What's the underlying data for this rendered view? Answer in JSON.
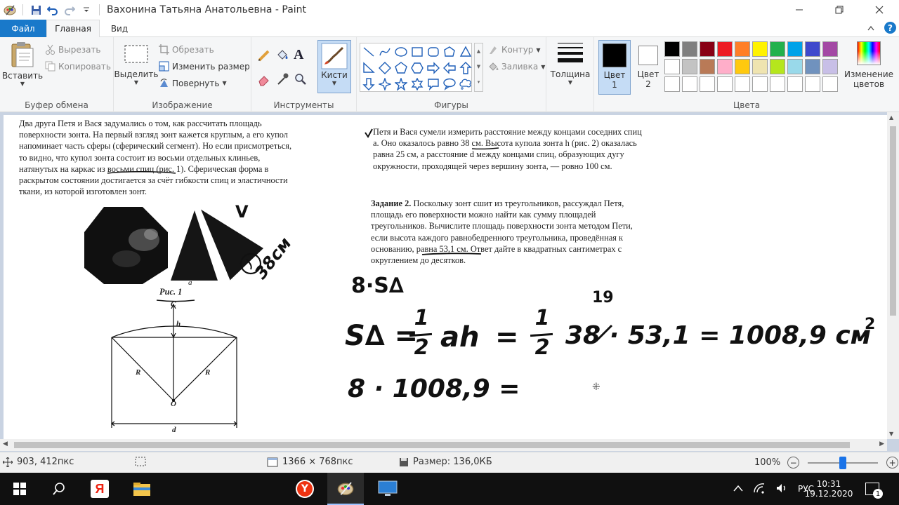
{
  "window": {
    "title": "Вахонина Татьяна Анатольевна - Paint"
  },
  "tabs": {
    "file": "Файл",
    "home": "Главная",
    "view": "Вид"
  },
  "ribbon": {
    "clipboard": {
      "label": "Буфер обмена",
      "paste": "Вставить",
      "cut": "Вырезать",
      "copy": "Копировать"
    },
    "image": {
      "label": "Изображение",
      "select": "Выделить",
      "crop": "Обрезать",
      "resize": "Изменить размер",
      "rotate": "Повернуть"
    },
    "tools": {
      "label": "Инструменты",
      "brushes": "Кисти"
    },
    "shapes": {
      "label": "Фигуры",
      "outline": "Контур",
      "fill": "Заливка"
    },
    "size": {
      "label": "Толщина"
    },
    "colors": {
      "label": "Цвета",
      "color1_line1": "Цвет",
      "color1_line2": "1",
      "color2_line1": "Цвет",
      "color2_line2": "2",
      "edit_line1": "Изменение",
      "edit_line2": "цветов",
      "color1_value": "#000000",
      "color2_value": "#ffffff",
      "palette": [
        "#000000",
        "#7f7f7f",
        "#880015",
        "#ed1c24",
        "#ff7f27",
        "#fff200",
        "#22b14c",
        "#00a2e8",
        "#3f48cc",
        "#a349a4",
        "#ffffff",
        "#c3c3c3",
        "#b97a57",
        "#ffaec9",
        "#ffc90e",
        "#efe4b0",
        "#b5e61d",
        "#99d9ea",
        "#7092be",
        "#c8bfe7",
        "#ffffff",
        "#ffffff",
        "#ffffff",
        "#ffffff",
        "#ffffff",
        "#ffffff",
        "#ffffff",
        "#ffffff",
        "#ffffff",
        "#ffffff"
      ]
    }
  },
  "document": {
    "left_paragraph": [
      "Два друга Петя и Вася задумались о том, как рассчитать площадь",
      "поверхности зонта. На первый взгляд зонт кажется круглым, а его купол",
      "напоминает часть сферы (сферический сегмент). Но если присмотреться,",
      "то видно, что купол зонта состоит из восьми отдельных клиньев,",
      "натянутых на каркас из восьми спиц (рис. 1). Сферическая форма в",
      "раскрытом состоянии достигается за счёт гибкости спиц и эластичности",
      "ткани, из которой изготовлен зонт."
    ],
    "right_paragraph": [
      "Петя и Вася сумели измерить расстояние между концами соседних спиц",
      "a. Оно оказалось равно 38 см. Высота купола зонта h (рис. 2) оказалась",
      "равна 25 см, а расстояние d между концами спиц, образующих дугу",
      "окружности, проходящей через вершину зонта, — ровно 100 см."
    ],
    "task_title": "Задание 2.",
    "task_paragraph": [
      "Поскольку зонт сшит из треугольников, рассуждал Петя,",
      "площадь его поверхности можно найти как сумму площадей",
      "треугольников. Вычислите площадь поверхности зонта методом Пети,",
      "если высота каждого равнобедренного треугольника, проведённая к",
      "основанию, равна 53,1 см. Ответ дайте в квадратных сантиметрах с",
      "округлением до десятков."
    ],
    "fig1_caption": "Рис. 1",
    "fig1_label_a": "a",
    "fig2_labels": {
      "C": "C",
      "h": "h",
      "R_left": "R",
      "R_right": "R",
      "O": "O",
      "d": "d"
    }
  },
  "handwriting": {
    "tick": "V",
    "size_note": "38см",
    "line1": "8·S∆",
    "small_19": "19",
    "formula_left": "S∆ =",
    "half_num": "1",
    "half_den": "2",
    "ah": "ah",
    "eq": "=",
    "half2_num": "1",
    "half2_den": "2",
    "mult": "38 · 53,1 = 1008,9 см",
    "exp": "2",
    "line3": "8 · 1008,9 ="
  },
  "status": {
    "cursor_pos": "903, 412пкс",
    "canvas_size": "1366 × 768пкс",
    "file_size": "Размер: 136,0КБ",
    "zoom": "100%",
    "zoom_fraction": 0.5
  },
  "taskbar": {
    "lang": "РУС",
    "time": "10:31",
    "date": "19.12.2020",
    "notif_count": "1"
  }
}
